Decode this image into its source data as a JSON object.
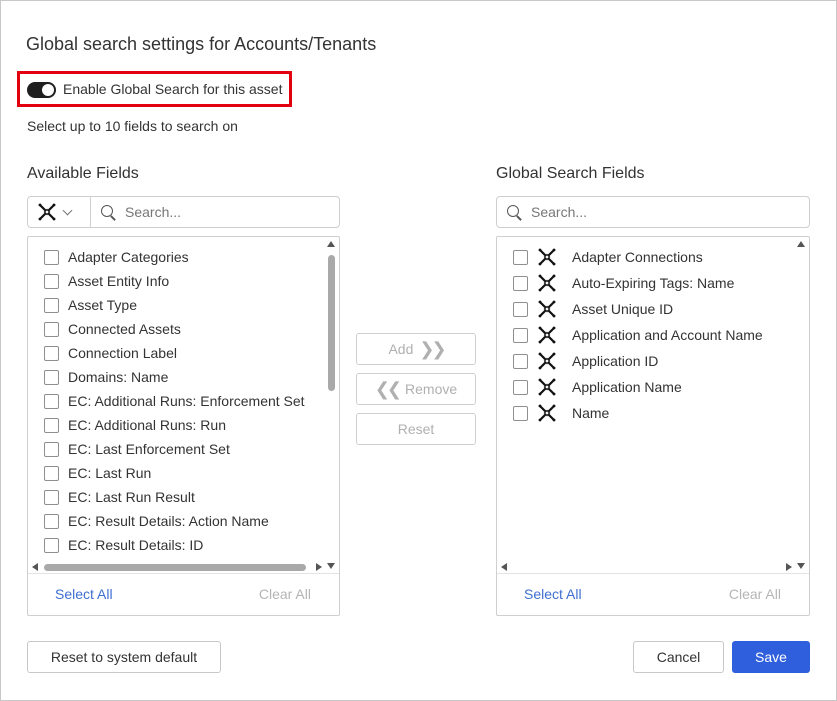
{
  "dialog": {
    "title": "Global search settings for Accounts/Tenants",
    "toggle_label": "Enable Global Search for this asset",
    "toggle_on": true,
    "hint": "Select up to 10 fields to search on"
  },
  "available": {
    "label": "Available Fields",
    "search_placeholder": "Search...",
    "adapter_icon": "adapter-generic-icon",
    "items": [
      "Adapter Categories",
      "Asset Entity Info",
      "Asset Type",
      "Connected Assets",
      "Connection Label",
      "Domains: Name",
      "EC: Additional Runs: Enforcement Set",
      "EC: Additional Runs: Run",
      "EC: Last Enforcement Set",
      "EC: Last Run",
      "EC: Last Run Result",
      "EC: Result Details: Action Name",
      "EC: Result Details: ID"
    ],
    "select_all": "Select All",
    "clear_all": "Clear All"
  },
  "selected": {
    "label": "Global Search Fields",
    "search_placeholder": "Search...",
    "items": [
      "Adapter Connections",
      "Auto-Expiring Tags: Name",
      "Asset Unique ID",
      "Application and Account Name",
      "Application ID",
      "Application Name",
      "Name"
    ],
    "select_all": "Select All",
    "clear_all": "Clear All"
  },
  "transfer": {
    "add": "Add",
    "remove": "Remove",
    "reset": "Reset"
  },
  "footer": {
    "reset_default": "Reset to system default",
    "cancel": "Cancel",
    "save": "Save"
  },
  "colors": {
    "accent": "#2f5fdc",
    "link": "#3f6fd1",
    "highlight": "#e3000f",
    "disabled": "#b0b0b0"
  }
}
